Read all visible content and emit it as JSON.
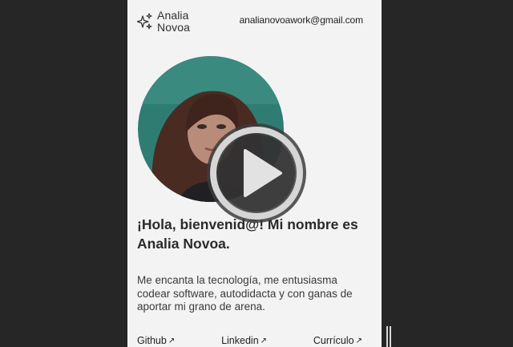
{
  "brand": {
    "first_name": "Analia",
    "last_name": "Novoa",
    "icon": "sparkles-icon"
  },
  "header": {
    "email": "analianovoawork@gmail.com"
  },
  "hero": {
    "headline": "¡Hola, bienvenid@! Mi nombre es Analia Novoa.",
    "intro": "Me encanta la tecnología, me entusiasma codear software, autodidacta y con ganas de aportar mi grano de arena."
  },
  "links": [
    {
      "label": "Github",
      "icon": "arrow-up-right-icon"
    },
    {
      "label": "Linkedin",
      "icon": "arrow-up-right-icon"
    },
    {
      "label": "Currículo",
      "icon": "arrow-up-right-icon"
    }
  ],
  "video_overlay": {
    "icon": "play-icon"
  },
  "colors": {
    "page_bg": "#f3f3f3",
    "outer_bg": "#262626",
    "avatar_bg": "#2f7c73"
  }
}
